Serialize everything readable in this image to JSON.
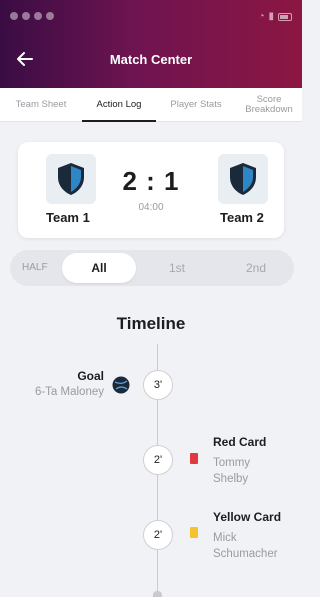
{
  "header": {
    "title": "Match Center"
  },
  "tabs": [
    {
      "label": "Team Sheet"
    },
    {
      "label": "Action Log"
    },
    {
      "label": "Player Stats"
    },
    {
      "label": "Score\nBreakdown"
    }
  ],
  "match": {
    "home_team": "Team 1",
    "away_team": "Team 2",
    "score": "2 : 1",
    "time": "04:00"
  },
  "half_filter": {
    "label": "HALF",
    "options": [
      "All",
      "1st",
      "2nd"
    ],
    "selected": "All"
  },
  "timeline": {
    "title": "Timeline",
    "events": [
      {
        "minute": "3'",
        "title": "Goal",
        "detail": "6-Ta Maloney",
        "icon": "soccer-ball-icon",
        "side": "left"
      },
      {
        "minute": "2'",
        "title": "Red Card",
        "detail": "Tommy\nShelby",
        "icon": "red-card-icon",
        "side": "right"
      },
      {
        "minute": "2'",
        "title": "Yellow Card",
        "detail": "Mick\nSchumacher",
        "icon": "yellow-card-icon",
        "side": "right"
      }
    ]
  },
  "colors": {
    "header_gradient_start": "#3a0c44",
    "header_gradient_end": "#8c1642",
    "red_card": "#e0393e",
    "yellow_card": "#f4c430",
    "shield_dark": "#1b2a3a",
    "shield_light": "#2f86c4"
  }
}
